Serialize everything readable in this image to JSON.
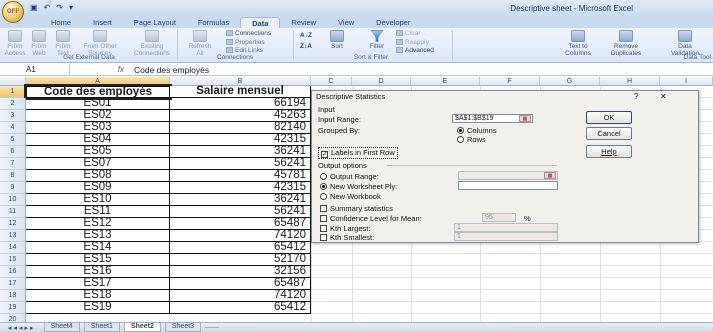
{
  "window": {
    "title": "Descriptive sheet - Microsoft Excel",
    "office_button": "OFF"
  },
  "ribbon_tabs": [
    {
      "label": "Home"
    },
    {
      "label": "Insert"
    },
    {
      "label": "Page Layout"
    },
    {
      "label": "Formulas"
    },
    {
      "label": "Data",
      "active": true
    },
    {
      "label": "Review"
    },
    {
      "label": "View"
    },
    {
      "label": "Developer"
    }
  ],
  "ribbon": {
    "from_access": "From\nAccess",
    "from_web": "From\nWeb",
    "from_text": "From\nText",
    "from_other": "From Other\nSources",
    "existing": "Existing\nConnections",
    "refresh": "Refresh\nAll",
    "connections": "Connections",
    "properties": "Properties",
    "edit_links": "Edit Links",
    "sort_az": "A↓Z",
    "sort_za": "Z↓A",
    "sort": "Sort",
    "filter": "Filter",
    "clear": "Clear",
    "reapply": "Reapply",
    "advanced": "Advanced",
    "text_to_columns": "Text to\nColumns",
    "remove_duplicates": "Remove\nDuplicates",
    "data_validation": "Data\nValidation",
    "group_external": "Get External Data",
    "group_connections": "Connections",
    "group_sort": "Sort & Filter",
    "group_tools": "Data Tool"
  },
  "formula_bar": {
    "name_box": "A1",
    "fx": "fx",
    "content": "Code des employés"
  },
  "columns": [
    "A",
    "B",
    "C",
    "D",
    "E",
    "F",
    "G",
    "H",
    "I"
  ],
  "table": {
    "headers": [
      "Code des employés",
      "Salaire mensuel"
    ],
    "rows": [
      [
        "ES01",
        "66194"
      ],
      [
        "ES02",
        "45263"
      ],
      [
        "ES03",
        "82140"
      ],
      [
        "ES04",
        "42315"
      ],
      [
        "ES05",
        "36241"
      ],
      [
        "ES07",
        "56241"
      ],
      [
        "ES08",
        "45781"
      ],
      [
        "ES09",
        "42315"
      ],
      [
        "ES10",
        "36241"
      ],
      [
        "ES11",
        "56241"
      ],
      [
        "ES12",
        "65487"
      ],
      [
        "ES13",
        "74120"
      ],
      [
        "ES14",
        "65412"
      ],
      [
        "ES15",
        "52170"
      ],
      [
        "ES16",
        "32156"
      ],
      [
        "ES17",
        "65487"
      ],
      [
        "ES18",
        "74120"
      ],
      [
        "ES19",
        "65412"
      ]
    ],
    "row_numbers": [
      "1",
      "2",
      "3",
      "4",
      "5",
      "6",
      "7",
      "8",
      "9",
      "10",
      "11",
      "12",
      "13",
      "14",
      "15",
      "16",
      "17",
      "18",
      "19",
      "20"
    ]
  },
  "sheet_tabs": [
    {
      "label": "Sheet4"
    },
    {
      "label": "Sheet1"
    },
    {
      "label": "Sheet2",
      "active": true
    },
    {
      "label": "Sheet3"
    }
  ],
  "dialog": {
    "title": "Descriptive Statistics",
    "help_glyph": "?",
    "close_glyph": "✕",
    "input_section": "Input",
    "input_range_label": "Input Range:",
    "input_range_value": "$A$1:$B$19",
    "grouped_by_label": "Grouped By:",
    "columns_option": "Columns",
    "rows_option": "Rows",
    "labels_first_row": "Labels in First Row",
    "output_section": "Output options",
    "output_range": "Output Range:",
    "new_worksheet_ply": "New Worksheet Ply:",
    "new_workbook": "New Workbook",
    "summary_statistics": "Summary statistics",
    "confidence_level": "Confidence Level for Mean:",
    "confidence_value": "95",
    "percent": "%",
    "kth_largest": "Kth Largest:",
    "kth_largest_value": "1",
    "kth_smallest": "Kth Smallest:",
    "kth_smallest_value": "1",
    "ok": "OK",
    "cancel": "Cancel",
    "help": "Help"
  }
}
